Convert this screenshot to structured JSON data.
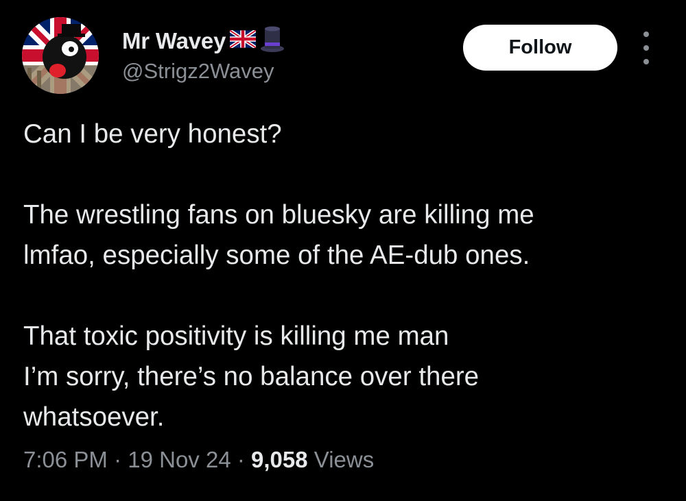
{
  "user": {
    "display_name": "Mr Wavey",
    "name_emojis": [
      "uk-flag-icon",
      "top-hat-icon"
    ],
    "handle": "@Strigz2Wavey"
  },
  "actions": {
    "follow_label": "Follow",
    "more_icon": "more-options-icon"
  },
  "tweet": {
    "paragraphs": [
      [
        "Can I be very honest?"
      ],
      [
        "The wrestling fans on bluesky are killing me",
        "lmfao, especially some of the AE-dub ones."
      ],
      [
        "That toxic positivity is killing me man",
        "I’m sorry, there’s no balance over there",
        "whatsoever."
      ]
    ],
    "time": "7:06 PM",
    "separator": "·",
    "date": "19 Nov 24",
    "views_count": "9,058",
    "views_label": "Views"
  },
  "colors": {
    "background": "#000000",
    "text_primary": "#e7e9ea",
    "text_secondary": "#8b9096",
    "follow_bg": "#ffffff",
    "follow_text": "#0f1419"
  }
}
